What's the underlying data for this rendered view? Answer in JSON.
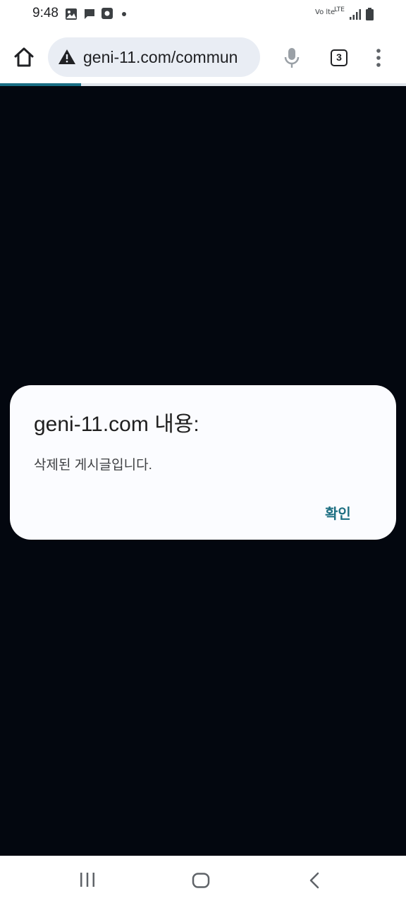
{
  "status_bar": {
    "time": "9:48",
    "volte_label": "Vo lte",
    "network_label": "LTE"
  },
  "browser": {
    "url": "geni-11.com/commun",
    "tab_count": "3",
    "page_load_progress": 0.2
  },
  "dialog": {
    "title": "geni-11.com 내용:",
    "message": "삭제된 게시글입니다.",
    "ok_label": "확인"
  },
  "colors": {
    "page_background": "#03070f",
    "accent": "#1d6f82",
    "url_bar": "#e9edf4"
  }
}
